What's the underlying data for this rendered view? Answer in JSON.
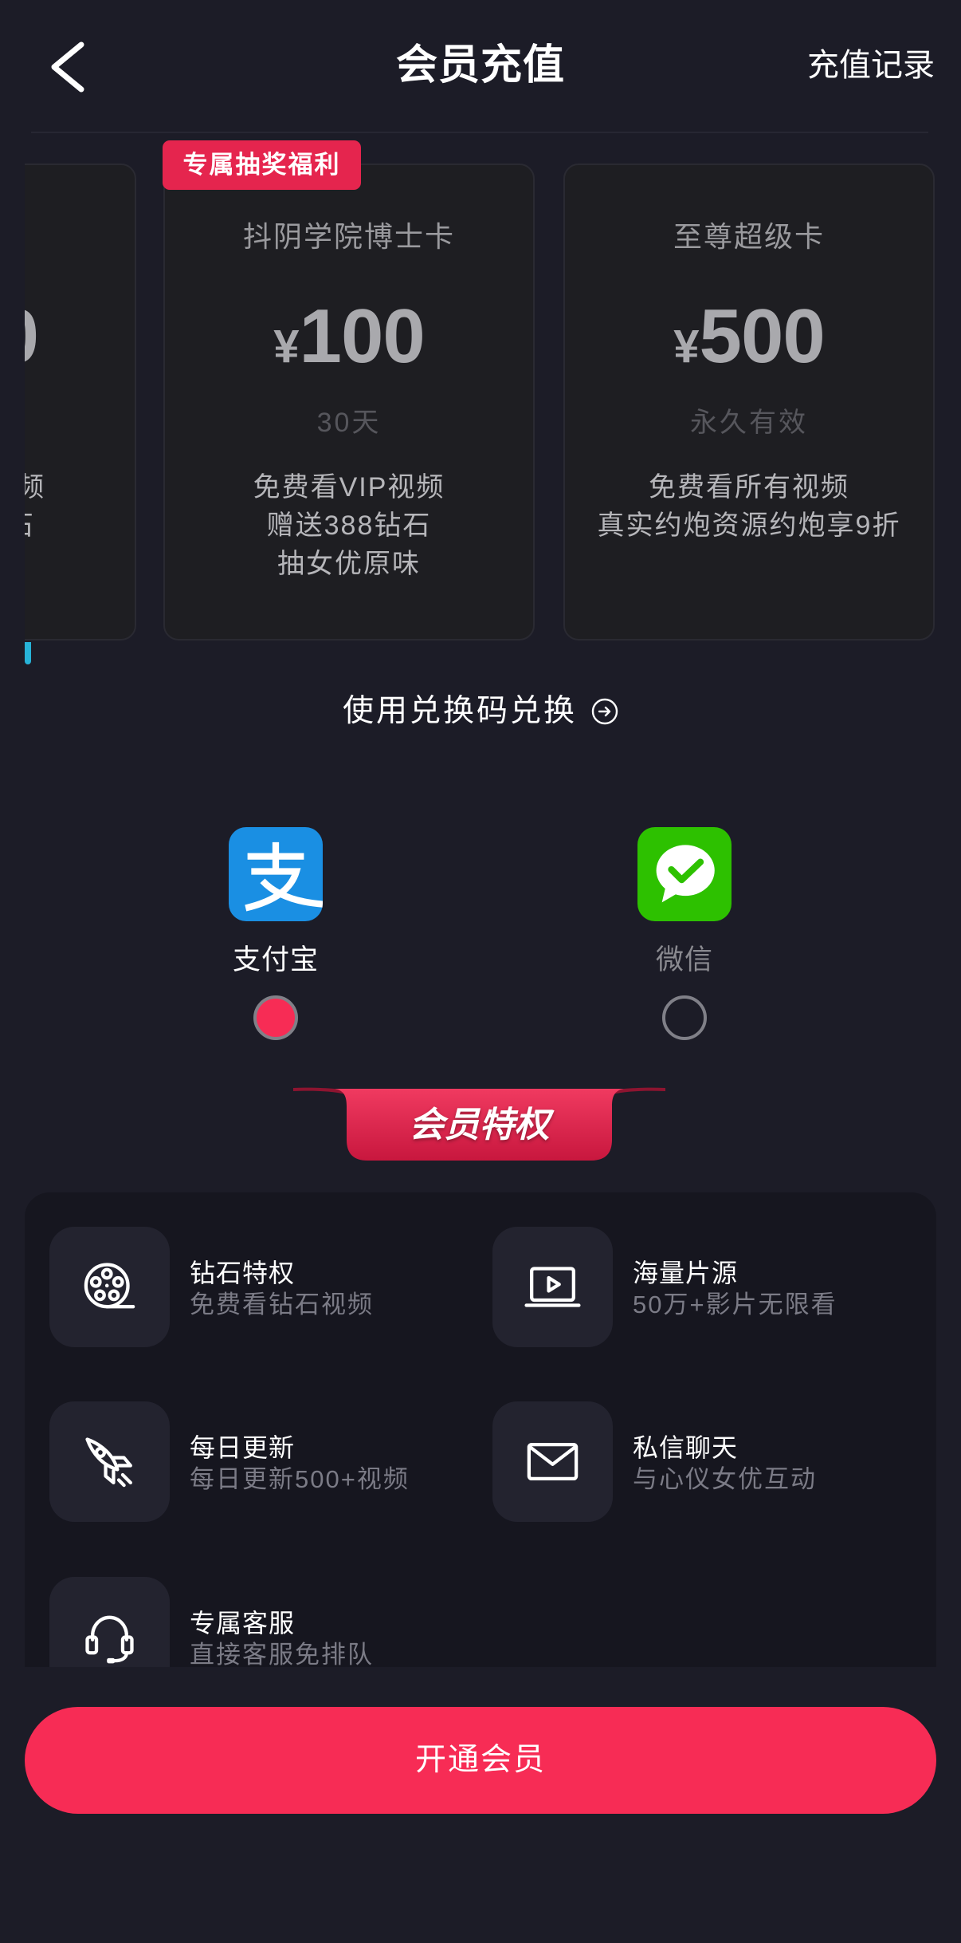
{
  "header": {
    "title": "会员充值",
    "back_icon": "chevron-left-icon",
    "records_label": "充值记录"
  },
  "plans": {
    "partial_left": {
      "price_fragment": "0",
      "benefit_fragments": [
        "频",
        "石"
      ]
    },
    "cards": [
      {
        "badge": "专属抽奖福利",
        "name": "抖阴学院博士卡",
        "currency": "¥",
        "price": "100",
        "duration": "30天",
        "benefits": [
          "免费看VIP视频",
          "赠送388钻石",
          "抽女优原味"
        ]
      },
      {
        "name": "至尊超级卡",
        "currency": "¥",
        "price": "500",
        "duration": "永久有效",
        "benefits": [
          "免费看所有视频",
          "真实约炮资源约炮享9折"
        ]
      }
    ]
  },
  "redeem": {
    "label": "使用兑换码兑换",
    "icon": "arrow-right-circle-icon"
  },
  "payment": {
    "methods": [
      {
        "name": "支付宝",
        "icon": "alipay-icon",
        "logo_text": "支",
        "selected": true
      },
      {
        "name": "微信",
        "icon": "wechat-pay-icon",
        "selected": false
      }
    ]
  },
  "privileges": {
    "title": "会员特权",
    "items": [
      {
        "title": "钻石特权",
        "subtitle": "免费看钻石视频",
        "icon": "film-reel-icon"
      },
      {
        "title": "海量片源",
        "subtitle": "50万+影片无限看",
        "icon": "video-screen-icon"
      },
      {
        "title": "每日更新",
        "subtitle": "每日更新500+视频",
        "icon": "rocket-icon"
      },
      {
        "title": "私信聊天",
        "subtitle": "与心仪女优互动",
        "icon": "envelope-icon"
      },
      {
        "title": "专属客服",
        "subtitle": "直接客服免排队",
        "icon": "headset-icon"
      }
    ]
  },
  "cta": {
    "label": "开通会员"
  },
  "colors": {
    "background": "#1c1c27",
    "panel": "#16161f",
    "accent": "#f72c55",
    "badge": "#e5254e",
    "alipay": "#1a8fe3",
    "wechat": "#2dc100"
  }
}
